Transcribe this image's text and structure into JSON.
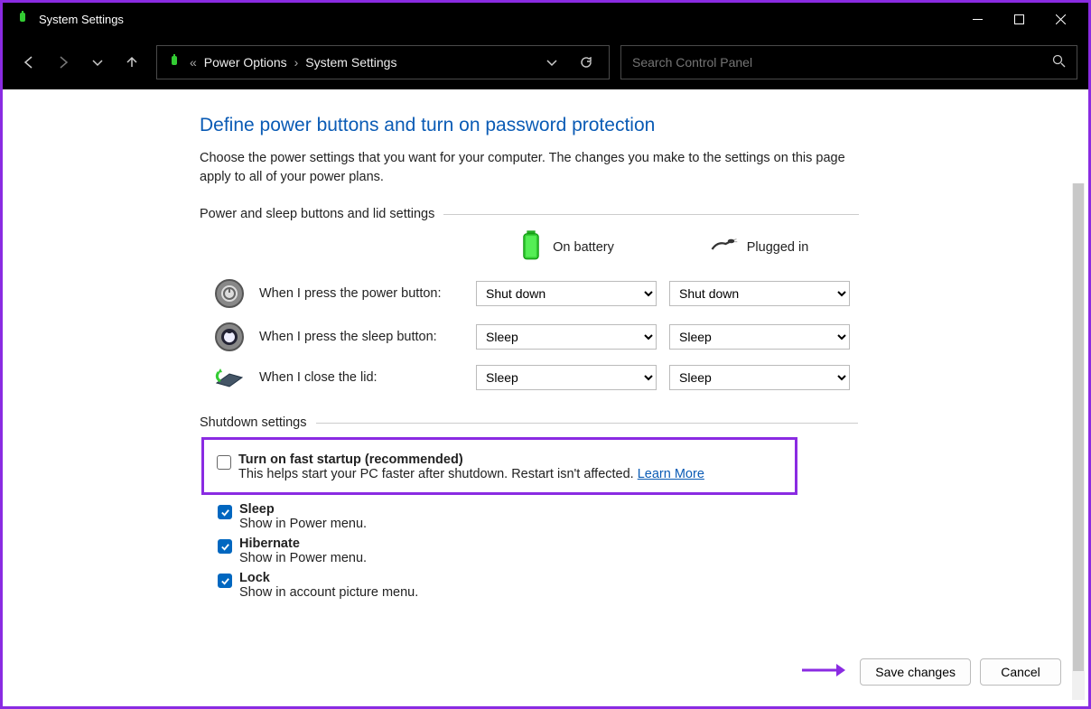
{
  "window": {
    "title": "System Settings"
  },
  "breadcrumb": {
    "item1": "Power Options",
    "item2": "System Settings"
  },
  "search": {
    "placeholder": "Search Control Panel"
  },
  "page": {
    "title": "Define power buttons and turn on password protection",
    "description": "Choose the power settings that you want for your computer. The changes you make to the settings on this page apply to all of your power plans.",
    "section1_label": "Power and sleep buttons and lid settings",
    "section2_label": "Shutdown settings"
  },
  "columns": {
    "battery": "On battery",
    "plugged": "Plugged in"
  },
  "rows": {
    "power_label": "When I press the power button:",
    "sleep_label": "When I press the sleep button:",
    "lid_label": "When I close the lid:",
    "power_battery": "Shut down",
    "power_plugged": "Shut down",
    "sleep_battery": "Sleep",
    "sleep_plugged": "Sleep",
    "lid_battery": "Sleep",
    "lid_plugged": "Sleep"
  },
  "shutdown": {
    "fast_startup": {
      "checked": false,
      "title": "Turn on fast startup (recommended)",
      "desc": "This helps start your PC faster after shutdown. Restart isn't affected. ",
      "link": "Learn More"
    },
    "sleep": {
      "checked": true,
      "title": "Sleep",
      "desc": "Show in Power menu."
    },
    "hibernate": {
      "checked": true,
      "title": "Hibernate",
      "desc": "Show in Power menu."
    },
    "lock": {
      "checked": true,
      "title": "Lock",
      "desc": "Show in account picture menu."
    }
  },
  "buttons": {
    "save": "Save changes",
    "cancel": "Cancel"
  }
}
